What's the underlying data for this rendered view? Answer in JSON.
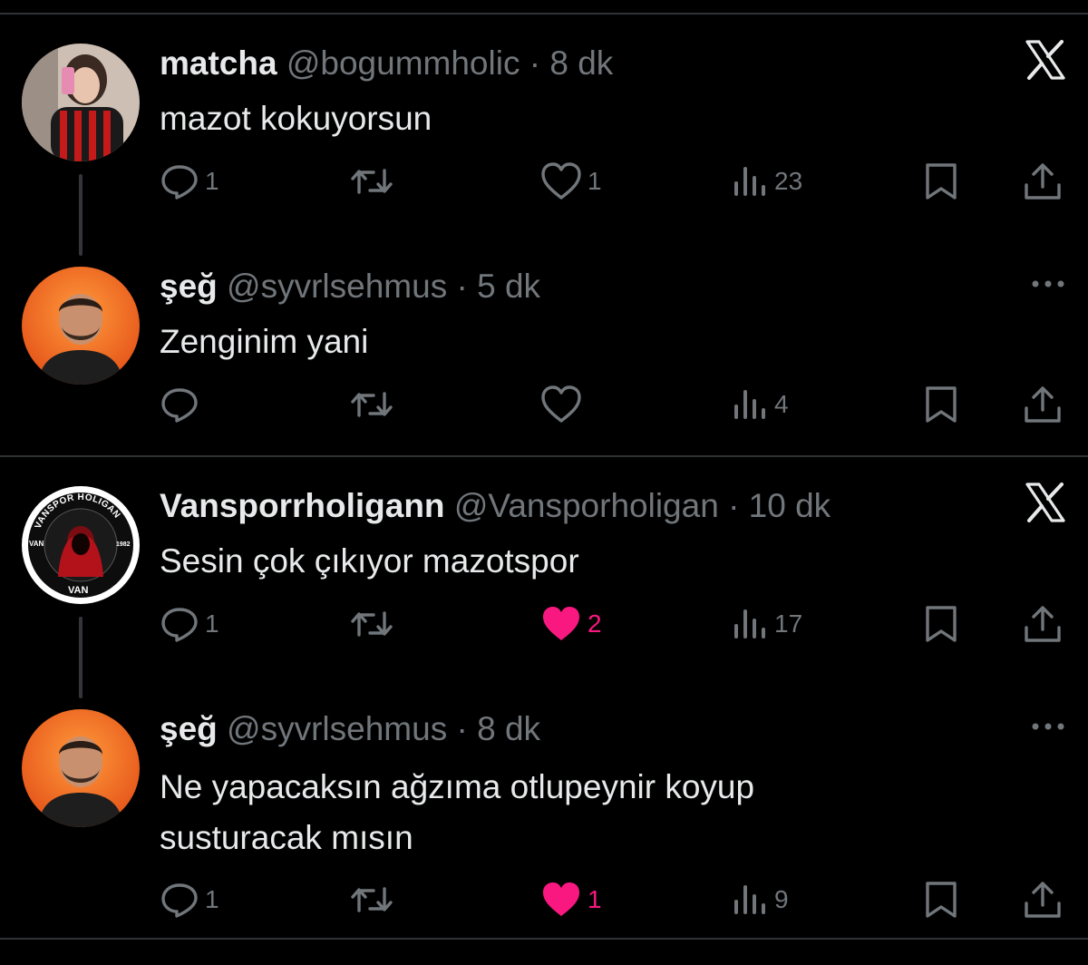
{
  "tweets": [
    {
      "name": "matcha",
      "handle": "@bogummholic",
      "time": "· 8 dk",
      "text": "mazot kokuyorsun",
      "corner": "x-logo-icon",
      "counts": {
        "reply": "1",
        "retweet": "",
        "like": "1",
        "views": "23"
      },
      "liked": false
    },
    {
      "name": "şeğ",
      "handle": "@syvrlsehmus",
      "time": "· 5 dk",
      "text": "Zenginim yani",
      "corner": "more-icon",
      "counts": {
        "reply": "",
        "retweet": "",
        "like": "",
        "views": "4"
      },
      "liked": false
    },
    {
      "name": "Vansporrholigann",
      "handle": "@Vansporholigan",
      "time": "· 10 dk",
      "text": "Sesin çok çıkıyor mazotspor",
      "corner": "x-logo-icon",
      "counts": {
        "reply": "1",
        "retweet": "",
        "like": "2",
        "views": "17"
      },
      "liked": true
    },
    {
      "name": "şeğ",
      "handle": "@syvrlsehmus",
      "time": "· 8 dk",
      "text_line1": "Ne yapacaksın ağzıma otlupeynir koyup",
      "text_line2": "susturacak mısın",
      "corner": "more-icon",
      "counts": {
        "reply": "1",
        "retweet": "",
        "like": "1",
        "views": "9"
      },
      "liked": true
    }
  ],
  "avatar3_logo": {
    "top": "VANSPOR HOLIGAN",
    "bottom": "VAN",
    "left": "VAN",
    "right": "1982"
  },
  "colors": {
    "background": "#000000",
    "text": "#e7e9ea",
    "muted": "#71767b",
    "like": "#f91880",
    "divider": "#2f3336"
  }
}
